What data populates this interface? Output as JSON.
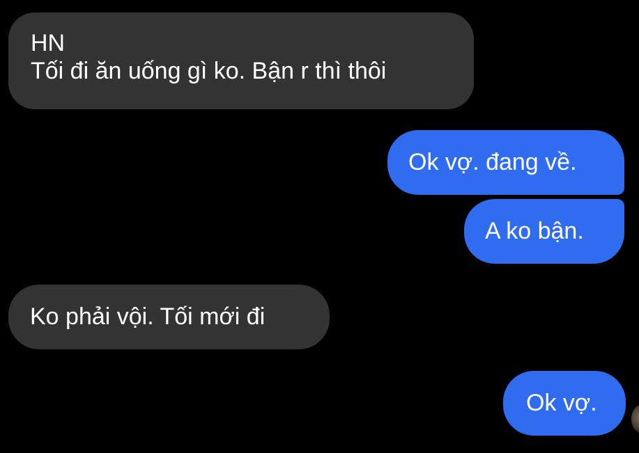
{
  "conversation": {
    "messages": [
      {
        "direction": "incoming",
        "sender": "HN",
        "text": "Tối đi ăn uống gì ko. Bận r thì thôi"
      },
      {
        "direction": "outgoing",
        "text": "Ok vợ. đang về."
      },
      {
        "direction": "outgoing",
        "text": "A ko bận."
      },
      {
        "direction": "incoming",
        "text": "Ko phải vội. Tối mới đi"
      },
      {
        "direction": "outgoing",
        "text": "Ok vợ."
      }
    ]
  },
  "colors": {
    "background": "#000000",
    "incoming_bubble": "#333333",
    "outgoing_bubble": "#2f6cf0",
    "text": "#ffffff"
  }
}
